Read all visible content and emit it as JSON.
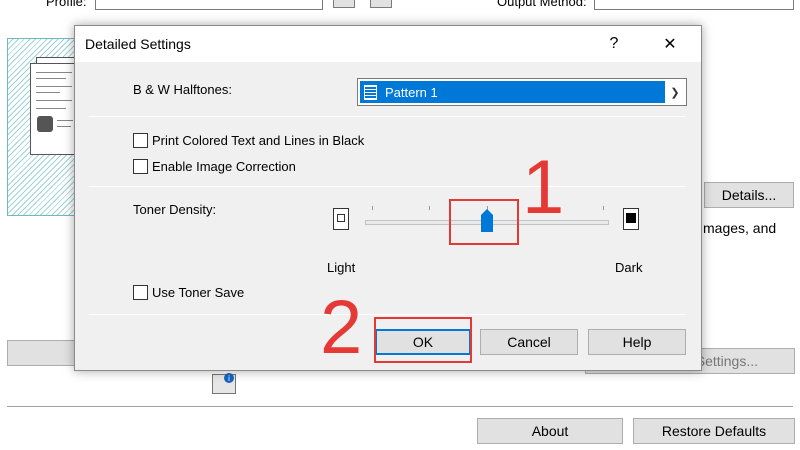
{
  "background": {
    "profile_label": "Profile:",
    "output_method_label": "Output Method:",
    "details_button": "Details...",
    "images_text": "mages, and",
    "settings_button": "Settings...",
    "about_button": "About",
    "restore_defaults_button": "Restore Defaults"
  },
  "dialog": {
    "title": "Detailed Settings",
    "help_icon": "?",
    "close_icon": "✕",
    "halftones_label": "B & W Halftones:",
    "halftones_value": "Pattern 1",
    "print_colored_text": "Print Colored Text and Lines in Black",
    "enable_image_correction": "Enable Image Correction",
    "toner_density_label": "Toner Density:",
    "light_label": "Light",
    "dark_label": "Dark",
    "toner_density_level": 0.5,
    "use_toner_save": "Use Toner Save",
    "ok_button": "OK",
    "cancel_button": "Cancel",
    "help_button": "Help"
  },
  "annotations": {
    "step1": "1",
    "step2": "2",
    "color": "#e53935"
  }
}
